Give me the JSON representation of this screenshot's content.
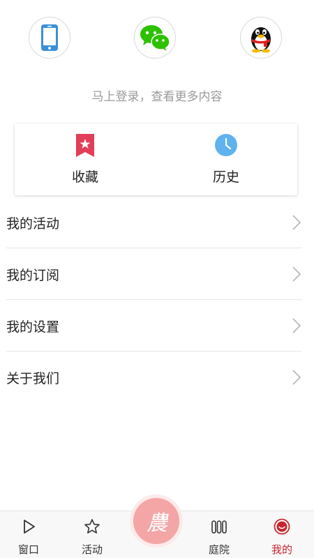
{
  "login": {
    "hint": "马上登录，查看更多内容",
    "icons": [
      "phone-icon",
      "wechat-icon",
      "qq-icon"
    ]
  },
  "shortcuts": {
    "favorites_label": "收藏",
    "history_label": "历史"
  },
  "menu": {
    "items": [
      {
        "label": "我的活动"
      },
      {
        "label": "我的订阅"
      },
      {
        "label": "我的设置"
      },
      {
        "label": "关于我们"
      }
    ]
  },
  "tabbar": {
    "window_label": "窗口",
    "activity_label": "活动",
    "center_glyph": "農",
    "center_plus": "+",
    "court_label": "庭院",
    "mine_label": "我的",
    "active_color": "#c4272e"
  },
  "colors": {
    "wechat_green": "#2dc100",
    "phone_blue": "#3b8fd9",
    "favorites_red": "#e23e57",
    "history_blue": "#5fb2ee",
    "center_pink": "#f4a6a6"
  }
}
